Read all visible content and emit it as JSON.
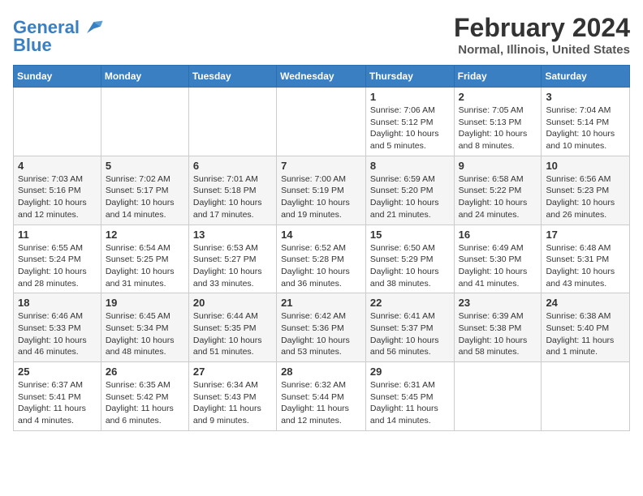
{
  "header": {
    "logo_line1": "General",
    "logo_line2": "Blue",
    "title": "February 2024",
    "subtitle": "Normal, Illinois, United States"
  },
  "days_of_week": [
    "Sunday",
    "Monday",
    "Tuesday",
    "Wednesday",
    "Thursday",
    "Friday",
    "Saturday"
  ],
  "weeks": [
    [
      {
        "day": "",
        "info": ""
      },
      {
        "day": "",
        "info": ""
      },
      {
        "day": "",
        "info": ""
      },
      {
        "day": "",
        "info": ""
      },
      {
        "day": "1",
        "info": "Sunrise: 7:06 AM\nSunset: 5:12 PM\nDaylight: 10 hours\nand 5 minutes."
      },
      {
        "day": "2",
        "info": "Sunrise: 7:05 AM\nSunset: 5:13 PM\nDaylight: 10 hours\nand 8 minutes."
      },
      {
        "day": "3",
        "info": "Sunrise: 7:04 AM\nSunset: 5:14 PM\nDaylight: 10 hours\nand 10 minutes."
      }
    ],
    [
      {
        "day": "4",
        "info": "Sunrise: 7:03 AM\nSunset: 5:16 PM\nDaylight: 10 hours\nand 12 minutes."
      },
      {
        "day": "5",
        "info": "Sunrise: 7:02 AM\nSunset: 5:17 PM\nDaylight: 10 hours\nand 14 minutes."
      },
      {
        "day": "6",
        "info": "Sunrise: 7:01 AM\nSunset: 5:18 PM\nDaylight: 10 hours\nand 17 minutes."
      },
      {
        "day": "7",
        "info": "Sunrise: 7:00 AM\nSunset: 5:19 PM\nDaylight: 10 hours\nand 19 minutes."
      },
      {
        "day": "8",
        "info": "Sunrise: 6:59 AM\nSunset: 5:20 PM\nDaylight: 10 hours\nand 21 minutes."
      },
      {
        "day": "9",
        "info": "Sunrise: 6:58 AM\nSunset: 5:22 PM\nDaylight: 10 hours\nand 24 minutes."
      },
      {
        "day": "10",
        "info": "Sunrise: 6:56 AM\nSunset: 5:23 PM\nDaylight: 10 hours\nand 26 minutes."
      }
    ],
    [
      {
        "day": "11",
        "info": "Sunrise: 6:55 AM\nSunset: 5:24 PM\nDaylight: 10 hours\nand 28 minutes."
      },
      {
        "day": "12",
        "info": "Sunrise: 6:54 AM\nSunset: 5:25 PM\nDaylight: 10 hours\nand 31 minutes."
      },
      {
        "day": "13",
        "info": "Sunrise: 6:53 AM\nSunset: 5:27 PM\nDaylight: 10 hours\nand 33 minutes."
      },
      {
        "day": "14",
        "info": "Sunrise: 6:52 AM\nSunset: 5:28 PM\nDaylight: 10 hours\nand 36 minutes."
      },
      {
        "day": "15",
        "info": "Sunrise: 6:50 AM\nSunset: 5:29 PM\nDaylight: 10 hours\nand 38 minutes."
      },
      {
        "day": "16",
        "info": "Sunrise: 6:49 AM\nSunset: 5:30 PM\nDaylight: 10 hours\nand 41 minutes."
      },
      {
        "day": "17",
        "info": "Sunrise: 6:48 AM\nSunset: 5:31 PM\nDaylight: 10 hours\nand 43 minutes."
      }
    ],
    [
      {
        "day": "18",
        "info": "Sunrise: 6:46 AM\nSunset: 5:33 PM\nDaylight: 10 hours\nand 46 minutes."
      },
      {
        "day": "19",
        "info": "Sunrise: 6:45 AM\nSunset: 5:34 PM\nDaylight: 10 hours\nand 48 minutes."
      },
      {
        "day": "20",
        "info": "Sunrise: 6:44 AM\nSunset: 5:35 PM\nDaylight: 10 hours\nand 51 minutes."
      },
      {
        "day": "21",
        "info": "Sunrise: 6:42 AM\nSunset: 5:36 PM\nDaylight: 10 hours\nand 53 minutes."
      },
      {
        "day": "22",
        "info": "Sunrise: 6:41 AM\nSunset: 5:37 PM\nDaylight: 10 hours\nand 56 minutes."
      },
      {
        "day": "23",
        "info": "Sunrise: 6:39 AM\nSunset: 5:38 PM\nDaylight: 10 hours\nand 58 minutes."
      },
      {
        "day": "24",
        "info": "Sunrise: 6:38 AM\nSunset: 5:40 PM\nDaylight: 11 hours\nand 1 minute."
      }
    ],
    [
      {
        "day": "25",
        "info": "Sunrise: 6:37 AM\nSunset: 5:41 PM\nDaylight: 11 hours\nand 4 minutes."
      },
      {
        "day": "26",
        "info": "Sunrise: 6:35 AM\nSunset: 5:42 PM\nDaylight: 11 hours\nand 6 minutes."
      },
      {
        "day": "27",
        "info": "Sunrise: 6:34 AM\nSunset: 5:43 PM\nDaylight: 11 hours\nand 9 minutes."
      },
      {
        "day": "28",
        "info": "Sunrise: 6:32 AM\nSunset: 5:44 PM\nDaylight: 11 hours\nand 12 minutes."
      },
      {
        "day": "29",
        "info": "Sunrise: 6:31 AM\nSunset: 5:45 PM\nDaylight: 11 hours\nand 14 minutes."
      },
      {
        "day": "",
        "info": ""
      },
      {
        "day": "",
        "info": ""
      }
    ]
  ]
}
